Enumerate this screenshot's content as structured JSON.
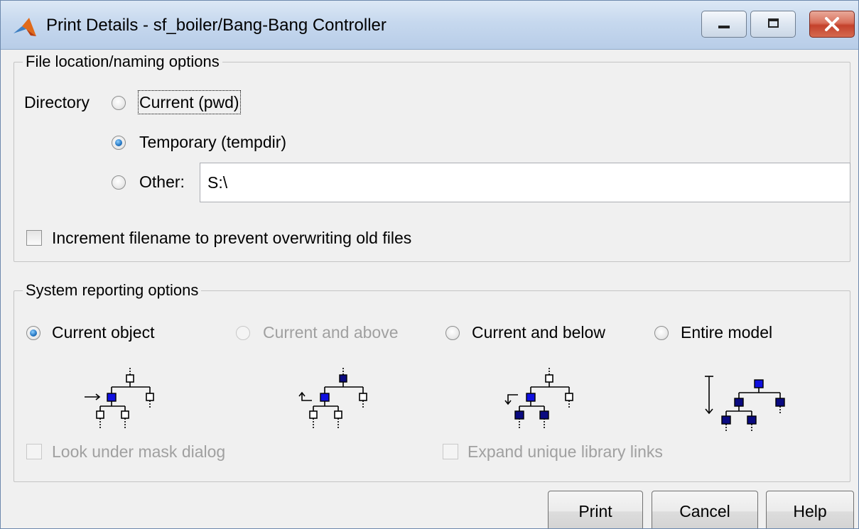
{
  "window": {
    "title": "Print Details - sf_boiler/Bang-Bang Controller"
  },
  "file_group": {
    "title": "File location/naming options",
    "directory_label": "Directory",
    "options": [
      {
        "label": "Current (pwd)",
        "checked": false
      },
      {
        "label": "Temporary (tempdir)",
        "checked": true
      },
      {
        "label": "Other:",
        "checked": false
      }
    ],
    "other_path_value": "S:\\",
    "increment_label": "Increment filename to prevent overwriting old files",
    "increment_checked": false
  },
  "system_group": {
    "title": "System reporting options",
    "options": [
      {
        "label": "Current object",
        "checked": true,
        "enabled": true,
        "icon": "tree-current-object-icon"
      },
      {
        "label": "Current and above",
        "checked": false,
        "enabled": false,
        "icon": "tree-current-and-above-icon"
      },
      {
        "label": "Current and below",
        "checked": false,
        "enabled": true,
        "icon": "tree-current-and-below-icon"
      },
      {
        "label": "Entire model",
        "checked": false,
        "enabled": true,
        "icon": "tree-entire-model-icon"
      }
    ],
    "look_under_mask_label": "Look under mask dialog",
    "look_under_mask_enabled": false,
    "expand_links_label": "Expand unique library links",
    "expand_links_enabled": false
  },
  "buttons": {
    "print": "Print",
    "cancel": "Cancel",
    "help": "Help"
  },
  "colors": {
    "node_selected": "#1010e0",
    "node_dark": "#0a0a80"
  }
}
